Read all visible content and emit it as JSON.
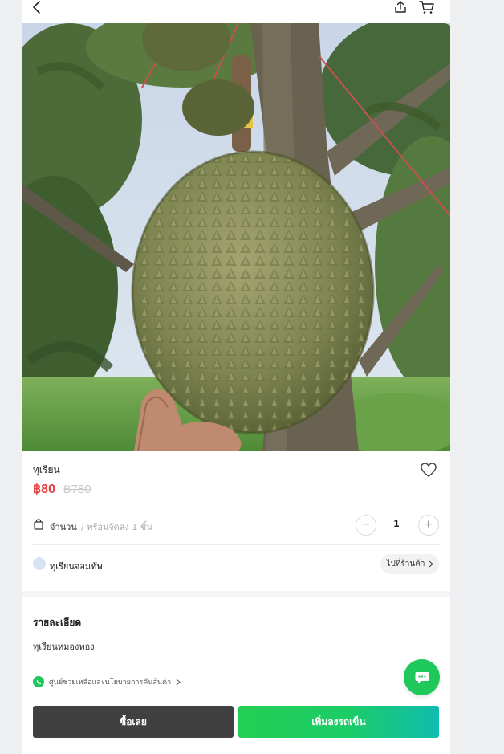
{
  "header": {
    "back_icon": "chevron-left-icon",
    "share_icon": "share-icon",
    "cart_icon": "cart-icon"
  },
  "product": {
    "image_alt": "durian-photo",
    "title": "ทุเรียน",
    "price_sale": "฿80",
    "price_original": "฿780",
    "wishlist_icon": "heart-icon"
  },
  "quantity": {
    "label": "จำนวน",
    "stock_text": "/ พร้อมจัดส่ง 1 ชิ้น",
    "value": "1",
    "minus_label": "−",
    "plus_label": "+"
  },
  "shop": {
    "name": "ทุเรียนจอมทัพ",
    "visit_label": "ไปที่ร้านค้า"
  },
  "details": {
    "heading": "รายละเอียด",
    "text": "ทุเรียนหมองทอง",
    "help_text": "ศูนย์ช่วยเหลือและนโยบายการคืนสินค้า"
  },
  "actions": {
    "buy_now": "ซื้อเลย",
    "add_to_cart": "เพิ่มลงรถเข็น"
  },
  "colors": {
    "sale_price": "#e53e3e",
    "primary_green": "#1ec85b",
    "buy_button": "#404040",
    "gradient_end": "#0fbcb0"
  }
}
